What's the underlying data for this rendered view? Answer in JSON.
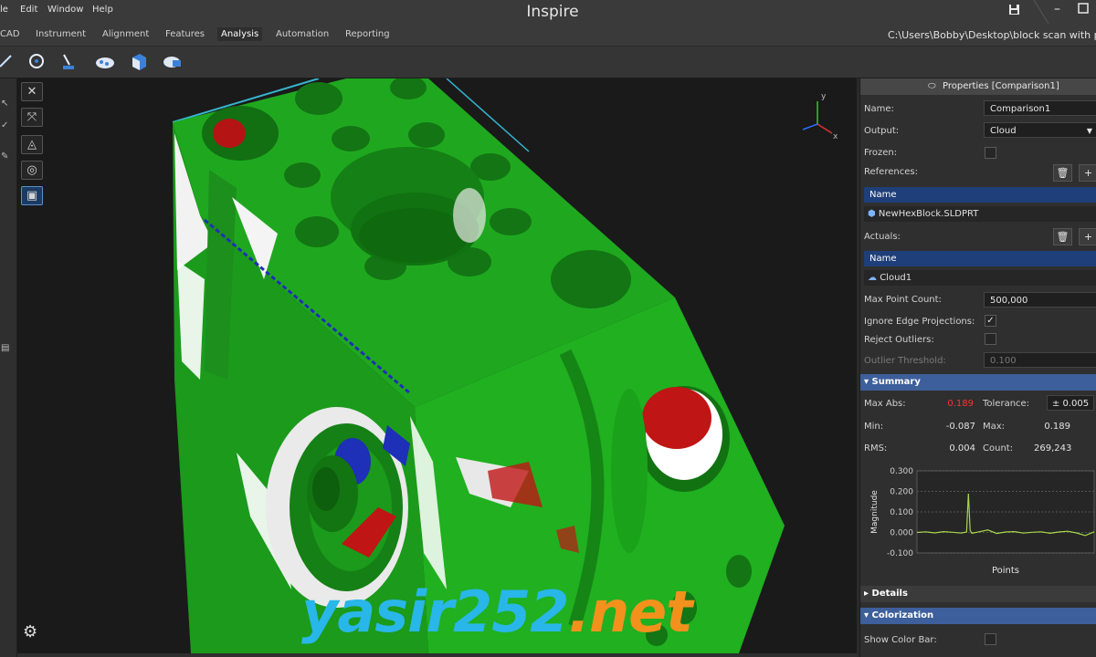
{
  "window": {
    "app_title": "Inspire",
    "file_path": "C:\\Users\\Bobby\\Desktop\\block scan with pin"
  },
  "menu": [
    "le",
    "Edit",
    "Window",
    "Help"
  ],
  "tabs": [
    {
      "label": "CAD"
    },
    {
      "label": "Instrument"
    },
    {
      "label": "Alignment"
    },
    {
      "label": "Features"
    },
    {
      "label": "Analysis",
      "active": true
    },
    {
      "label": "Automation"
    },
    {
      "label": "Reporting"
    }
  ],
  "toolbar_icons": [
    "measure-icon",
    "circle-feature-icon",
    "probe-icon",
    "cloud-compare-icon",
    "cube-icon",
    "cloud-camera-icon"
  ],
  "viewport": {
    "tools": [
      "fit-icon",
      "zoom-extents-icon",
      "view-orient-icon",
      "render-mode-icon",
      "camera-icon"
    ],
    "axis_labels": {
      "x": "x",
      "y": "y"
    },
    "colors": {
      "in_tolerance": "#1fb41f",
      "above": "#c01515",
      "below": "#1e2fb8",
      "no_data": "#ffffff",
      "background": "#1a1a1a"
    }
  },
  "properties": {
    "header": "Properties [Comparison1]",
    "name_label": "Name:",
    "name_value": "Comparison1",
    "output_label": "Output:",
    "output_value": "Cloud",
    "frozen_label": "Frozen:",
    "references_label": "References:",
    "references_col": "Name",
    "references_items": [
      "NewHexBlock.SLDPRT"
    ],
    "actuals_label": "Actuals:",
    "actuals_col": "Name",
    "actuals_items": [
      "Cloud1"
    ],
    "max_point_label": "Max Point Count:",
    "max_point_value": "500,000",
    "ignore_edge_label": "Ignore Edge Projections:",
    "ignore_edge_checked": true,
    "reject_outliers_label": "Reject Outliers:",
    "outlier_threshold_label": "Outlier Threshold:",
    "outlier_threshold_value": "0.100"
  },
  "summary": {
    "title": "Summary",
    "max_abs_label": "Max Abs:",
    "max_abs_value": "0.189",
    "tolerance_label": "Tolerance:",
    "tolerance_value": "± 0.005",
    "min_label": "Min:",
    "min_value": "-0.087",
    "max_label": "Max:",
    "max_value": "0.189",
    "rms_label": "RMS:",
    "rms_value": "0.004",
    "count_label": "Count:",
    "count_value": "269,243"
  },
  "chart_data": {
    "type": "line",
    "xlabel": "Points",
    "ylabel": "Magnitude",
    "ylim": [
      -0.1,
      0.3
    ],
    "yticks": [
      "0.300",
      "0.200",
      "0.100",
      "0.000",
      "-0.100"
    ],
    "grid": true,
    "series": [
      {
        "color": "#a8d84a",
        "x": [
          0,
          5,
          10,
          15,
          20,
          25,
          28,
          29,
          30,
          31,
          35,
          40,
          45,
          50,
          55,
          60,
          65,
          70,
          75,
          80,
          85,
          90,
          95,
          100
        ],
        "y": [
          0.0,
          0.003,
          -0.002,
          0.004,
          0.001,
          -0.003,
          0.002,
          0.189,
          0.01,
          -0.004,
          0.003,
          0.012,
          -0.005,
          0.002,
          0.004,
          -0.003,
          0.001,
          0.003,
          -0.004,
          0.002,
          0.006,
          -0.002,
          -0.015,
          0.003
        ]
      }
    ]
  },
  "details": {
    "title": "Details"
  },
  "colorization": {
    "title": "Colorization",
    "show_color_bar_label": "Show Color Bar:"
  },
  "watermark": {
    "part1": "yasir252",
    "part2": ".net"
  }
}
